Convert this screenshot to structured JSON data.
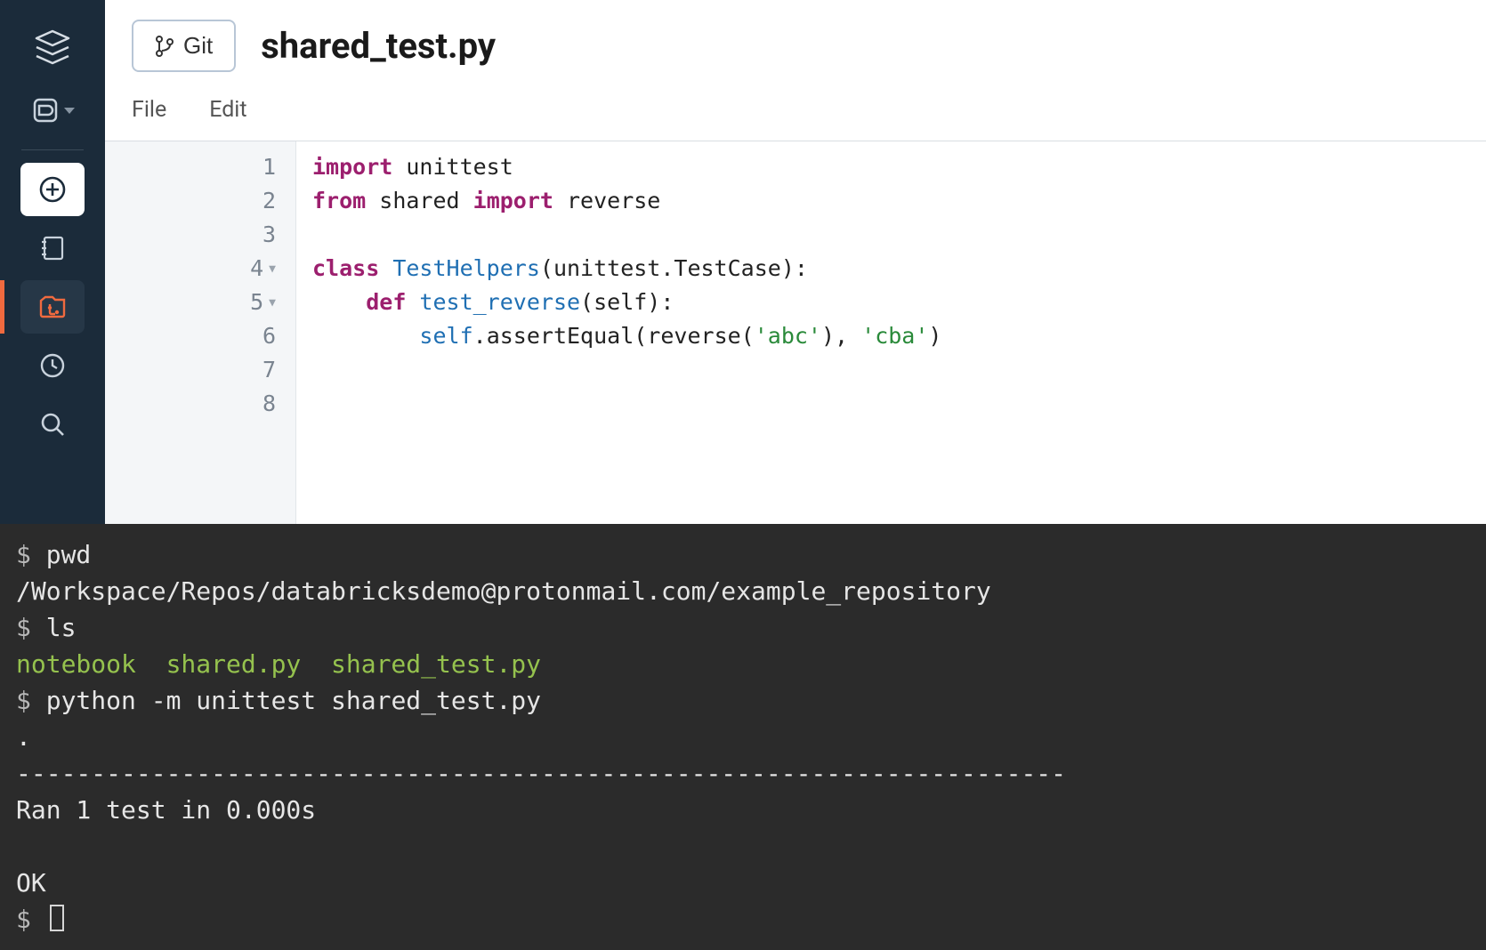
{
  "header": {
    "git_button_label": "Git",
    "file_title": "shared_test.py"
  },
  "menu": {
    "file": "File",
    "edit": "Edit"
  },
  "editor": {
    "lines": [
      {
        "n": "1",
        "fold": false
      },
      {
        "n": "2",
        "fold": false
      },
      {
        "n": "3",
        "fold": false
      },
      {
        "n": "4",
        "fold": true
      },
      {
        "n": "5",
        "fold": true
      },
      {
        "n": "6",
        "fold": false
      },
      {
        "n": "7",
        "fold": false
      },
      {
        "n": "8",
        "fold": false
      }
    ],
    "code": {
      "l1_kw1": "import",
      "l1_mod": " unittest",
      "l2_kw1": "from",
      "l2_mod": " shared ",
      "l2_kw2": "import",
      "l2_name": " reverse",
      "l4_kw": "class",
      "l4_cls": " TestHelpers",
      "l4_rest": "(unittest.TestCase):",
      "l5_kw": "def",
      "l5_fn": " test_reverse",
      "l5_rest": "(self):",
      "l6_self": "self",
      "l6_call": ".assertEqual(reverse(",
      "l6_s1": "'abc'",
      "l6_mid": "), ",
      "l6_s2": "'cba'",
      "l6_end": ")"
    }
  },
  "terminal": {
    "line1_prompt": "$ ",
    "line1_cmd": "pwd",
    "line2_out": "/Workspace/Repos/databricksdemo@protonmail.com/example_repository",
    "line3_prompt": "$ ",
    "line3_cmd": "ls",
    "line4_ls": "notebook  shared.py  shared_test.py",
    "line5_prompt": "$ ",
    "line5_cmd": "python -m unittest shared_test.py",
    "line6_dot": ".",
    "line7_rule": "----------------------------------------------------------------------",
    "line8_ran": "Ran 1 test in 0.000s",
    "line10_ok": "OK",
    "line11_prompt": "$ "
  },
  "icons": {
    "logo": "stack-icon",
    "data": "data-icon",
    "create": "plus-circle-icon",
    "notebook": "notebook-icon",
    "repos": "repos-icon",
    "recents": "clock-icon",
    "search": "search-icon",
    "git": "git-branch-icon"
  }
}
